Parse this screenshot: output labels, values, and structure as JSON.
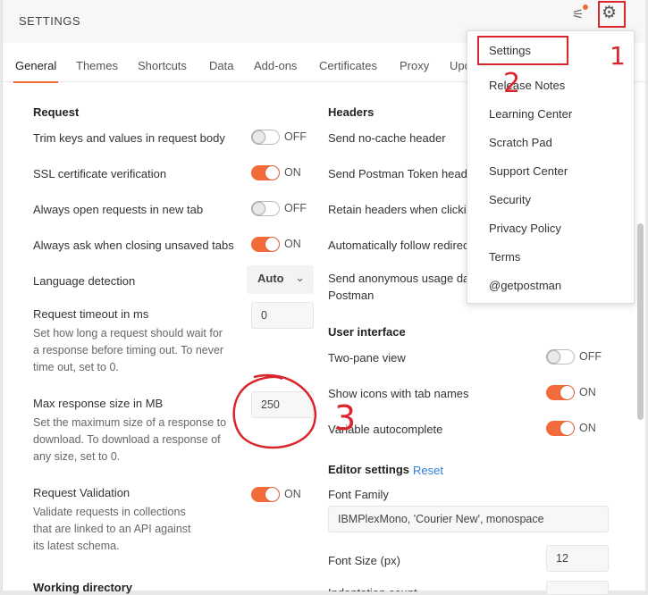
{
  "modal": {
    "title": "SETTINGS"
  },
  "tabs": [
    {
      "label": "General",
      "active": true
    },
    {
      "label": "Themes"
    },
    {
      "label": "Shortcuts"
    },
    {
      "label": "Data"
    },
    {
      "label": "Add-ons"
    },
    {
      "label": "Certificates"
    },
    {
      "label": "Proxy"
    },
    {
      "label": "Upd"
    }
  ],
  "request": {
    "title": "Request",
    "trim": {
      "label": "Trim keys and values in request body",
      "state": "OFF"
    },
    "ssl": {
      "label": "SSL certificate verification",
      "state": "ON"
    },
    "newtab": {
      "label": "Always open requests in new tab",
      "state": "OFF"
    },
    "askclose": {
      "label": "Always ask when closing unsaved tabs",
      "state": "ON"
    },
    "lang": {
      "label": "Language detection",
      "value": "Auto"
    },
    "timeout": {
      "label": "Request timeout in ms",
      "desc": [
        "Set how long a request should wait for",
        "a response before timing out. To never",
        "time out, set to 0."
      ],
      "value": "0"
    },
    "maxsize": {
      "label": "Max response size in MB",
      "desc": [
        "Set the maximum size of a response to",
        "download. To download a response of",
        "any size, set to 0."
      ],
      "value": "250"
    },
    "validation": {
      "label": "Request Validation",
      "desc": [
        "Validate requests in collections",
        "that are linked to an API against",
        "its latest schema."
      ],
      "state": "ON"
    },
    "workdir": {
      "label": "Working directory"
    }
  },
  "headers": {
    "title": "Headers",
    "nocache": "Send no-cache header",
    "token": "Send Postman Token heade",
    "retain": "Retain headers when clickin",
    "redirect": "Automatically follow redirec",
    "anon": [
      "Send anonymous usage dat",
      "Postman"
    ]
  },
  "ui": {
    "title": "User interface",
    "twopane": {
      "label": "Two-pane view",
      "state": "OFF"
    },
    "icons": {
      "label": "Show icons with tab names",
      "state": "ON"
    },
    "autocomplete": {
      "label": "Variable autocomplete",
      "state": "ON"
    }
  },
  "editor": {
    "title": "Editor settings",
    "reset": "Reset",
    "fontfamily": {
      "label": "Font Family",
      "value": "IBMPlexMono, 'Courier New', monospace"
    },
    "fontsize": {
      "label": "Font Size (px)",
      "value": "12"
    },
    "indent": {
      "label": "Indentation count"
    }
  },
  "menu": {
    "items": [
      "Settings",
      "Release Notes",
      "Learning Center",
      "Scratch Pad",
      "Support Center",
      "Security",
      "Privacy Policy",
      "Terms",
      "@getpostman"
    ]
  },
  "annotations": {
    "one": "1",
    "two": "2",
    "three": "3"
  },
  "colors": {
    "accent": "#f26b3a",
    "annotation": "#d9252b",
    "link": "#2b7fd6"
  }
}
